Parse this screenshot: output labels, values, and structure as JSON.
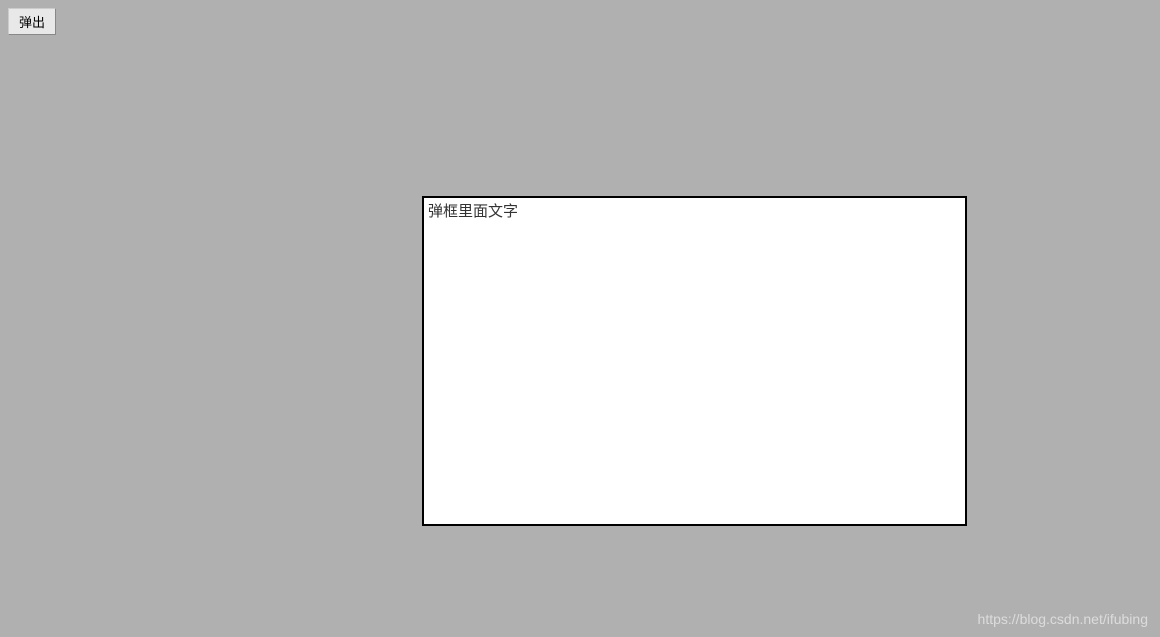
{
  "button": {
    "label": "弹出"
  },
  "dialog": {
    "text": "弹框里面文字"
  },
  "watermark": {
    "text": "https://blog.csdn.net/ifubing"
  }
}
